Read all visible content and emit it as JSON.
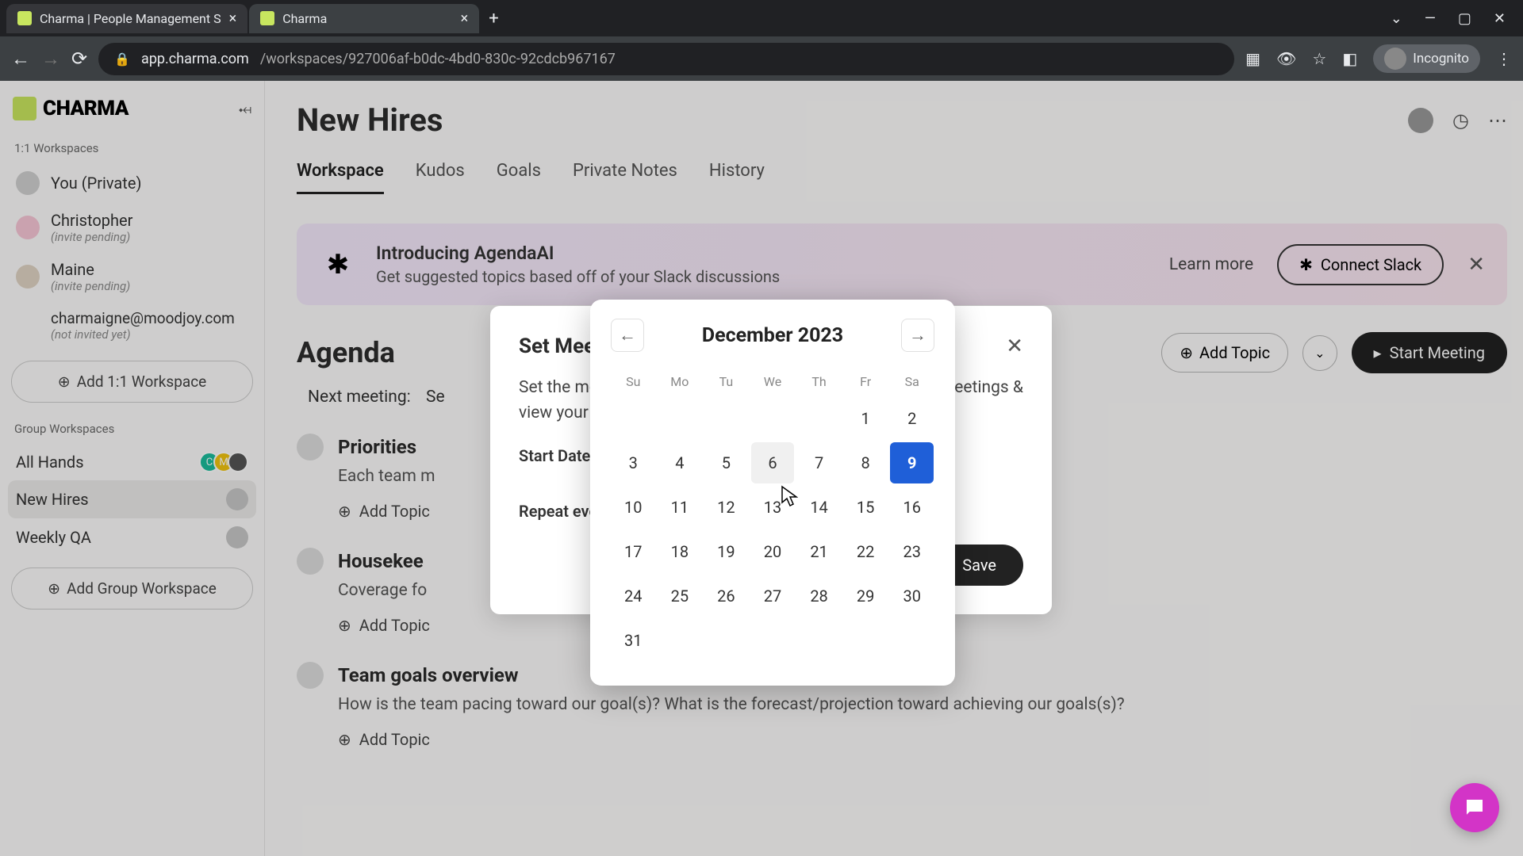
{
  "browser": {
    "tabs": [
      {
        "title": "Charma | People Management S",
        "active": false
      },
      {
        "title": "Charma",
        "active": true
      }
    ],
    "url_host": "app.charma.com",
    "url_path": "/workspaces/927006af-b0dc-4bd0-830c-92cdcb967167",
    "incognito_label": "Incognito"
  },
  "sidebar": {
    "logo_text": "CHARMA",
    "section_1on1": "1:1 Workspaces",
    "section_group": "Group Workspaces",
    "items_1on1": [
      {
        "name": "You (Private)",
        "sub": ""
      },
      {
        "name": "Christopher",
        "sub": "(invite pending)"
      },
      {
        "name": "Maine",
        "sub": "(invite pending)"
      },
      {
        "name": "charmaigne@moodjoy.com",
        "sub": "(not invited yet)"
      }
    ],
    "add_1on1": "Add 1:1 Workspace",
    "items_group": [
      {
        "name": "All Hands"
      },
      {
        "name": "New Hires"
      },
      {
        "name": "Weekly QA"
      }
    ],
    "add_group": "Add Group Workspace"
  },
  "main": {
    "title": "New Hires",
    "tabs": [
      "Workspace",
      "Kudos",
      "Goals",
      "Private Notes",
      "History"
    ],
    "active_tab": 0,
    "banner": {
      "title": "Introducing AgendaAI",
      "subtitle": "Get suggested topics based off of your Slack discussions",
      "learn": "Learn more",
      "connect": "Connect Slack"
    },
    "agenda_title": "Agenda",
    "add_topic": "Add Topic",
    "start_meeting": "Start Meeting",
    "next_meeting_label": "Next meeting:",
    "next_meeting_value": "Se",
    "items": [
      {
        "title": "Priorities",
        "desc": "Each team m",
        "add": "Add Topic"
      },
      {
        "title": "Housekee",
        "desc": "Coverage fo",
        "add": "Add Topic"
      },
      {
        "title": "Team goals overview",
        "desc": "How is the team pacing toward our goal(s)? What is the forecast/projection toward achieving our goals(s)?",
        "add": "Add Topic"
      }
    ]
  },
  "modal": {
    "title": "Set Meet",
    "body_line1": "Set the me",
    "body_line2": "eetings &",
    "body_line3": "view your",
    "start_date_label": "Start Date",
    "repeat_label": "Repeat eve",
    "save": "Save"
  },
  "calendar": {
    "month_label": "December 2023",
    "dow": [
      "Su",
      "Mo",
      "Tu",
      "We",
      "Th",
      "Fr",
      "Sa"
    ],
    "leading_blanks": 5,
    "days": 31,
    "selected": 9,
    "hover": 6
  }
}
